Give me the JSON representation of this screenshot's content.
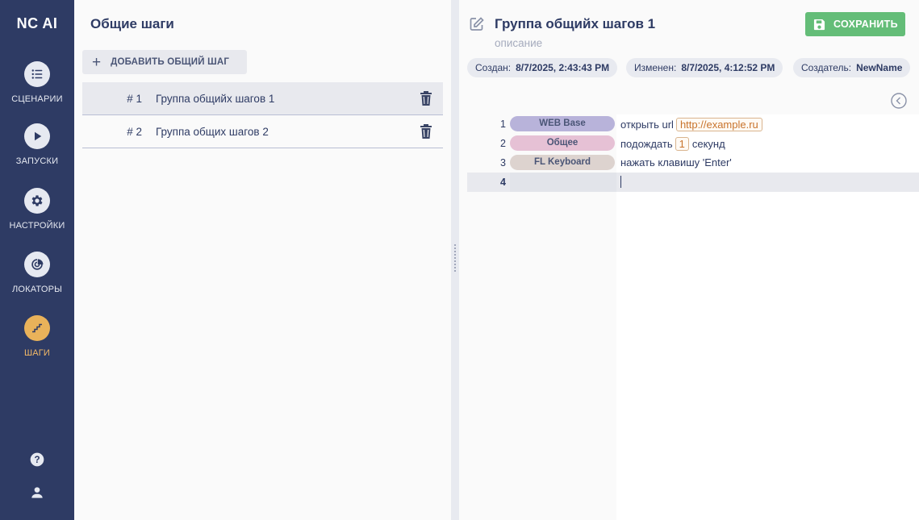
{
  "app": {
    "logo": "NC AI"
  },
  "sidebar": {
    "items": [
      {
        "label": "СЦЕНАРИИ",
        "icon": "list-icon",
        "active": false
      },
      {
        "label": "ЗАПУСКИ",
        "icon": "play-icon",
        "active": false
      },
      {
        "label": "НАСТРОЙКИ",
        "icon": "gear-icon",
        "active": false
      },
      {
        "label": "ЛОКАТОРЫ",
        "icon": "radar-icon",
        "active": false
      },
      {
        "label": "ШАГИ",
        "icon": "stairs-icon",
        "active": true
      }
    ],
    "bottom": [
      {
        "icon": "help-icon"
      },
      {
        "icon": "user-icon"
      }
    ],
    "active_color": "#e9b25a",
    "background": "#2e3b64"
  },
  "left_panel": {
    "title": "Общие шаги",
    "add_button_label": "ДОБАВИТЬ ОБЩИЙ ШАГ",
    "groups": [
      {
        "num": "# 1",
        "name": "Группа общийх шагов 1",
        "selected": true
      },
      {
        "num": "# 2",
        "name": "Группа общих шагов 2",
        "selected": false
      }
    ]
  },
  "right_panel": {
    "title": "Группа общийх шагов 1",
    "description": "описание",
    "save_label": "СОХРАНИТЬ",
    "save_color": "#64bd78",
    "meta": {
      "created_label": "Создан:",
      "created_value": "8/7/2025, 2:43:43 PM",
      "modified_label": "Изменен:",
      "modified_value": "8/7/2025, 4:12:52 PM",
      "creator_label": "Создатель:",
      "creator_value": "NewName"
    },
    "lines": [
      {
        "num": "1",
        "tag": "WEB Base",
        "tag_color": "#b8b3da",
        "text_before": "открыть url",
        "param": "http://example.ru",
        "text_after": ""
      },
      {
        "num": "2",
        "tag": "Общее",
        "tag_color": "#e6c1d5",
        "text_before": "подождать",
        "param": "1",
        "text_after": "секунд"
      },
      {
        "num": "3",
        "tag": "FL Keyboard",
        "tag_color": "#ddd3cf",
        "text_before": "нажать клавишу 'Enter'",
        "param": "",
        "text_after": ""
      },
      {
        "num": "4",
        "tag": "",
        "tag_color": "",
        "text_before": "",
        "param": "",
        "text_after": ""
      }
    ]
  }
}
